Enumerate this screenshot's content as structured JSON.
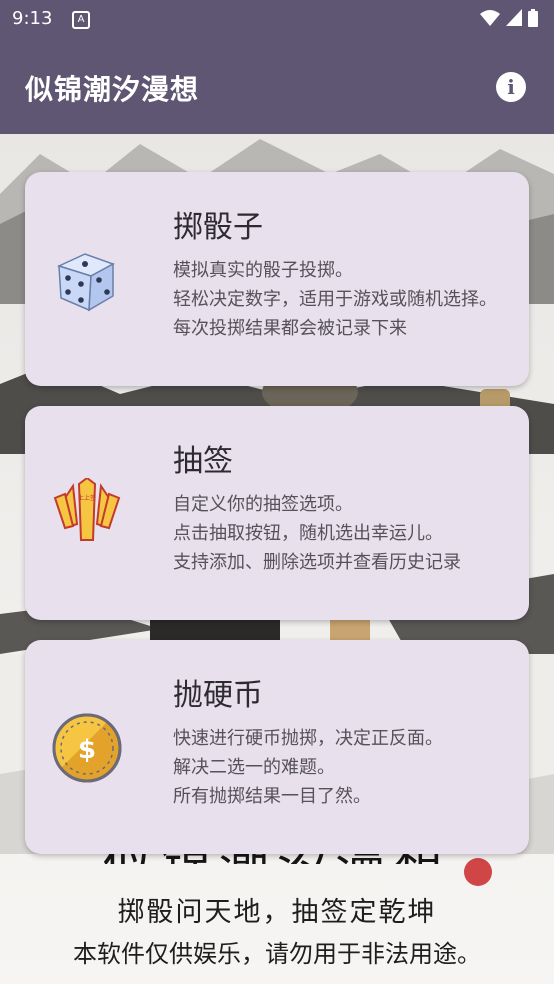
{
  "status": {
    "time": "9:13",
    "notif_glyph": "A"
  },
  "appbar": {
    "title": "似锦潮汐漫想"
  },
  "cards": [
    {
      "title": "掷骰子",
      "desc": [
        "模拟真实的骰子投掷。",
        "轻松决定数字，适用于游戏或随机选择。",
        "每次投掷结果都会被记录下来"
      ],
      "icon": "dice-icon"
    },
    {
      "title": "抽签",
      "desc": [
        "自定义你的抽签选项。",
        "点击抽取按钮，随机选出幸运儿。",
        "支持添加、删除选项并查看历史记录"
      ],
      "icon": "fortune-sticks-icon",
      "icon_text": "上上签"
    },
    {
      "title": "抛硬币",
      "desc": [
        "快速进行硬币抛掷，决定正反面。",
        "解决二选一的难题。",
        "所有抛掷结果一目了然。"
      ],
      "icon": "coin-icon",
      "icon_text": "$"
    }
  ],
  "background": {
    "calligraphy": "似锦潮汐漫想",
    "line1": "掷骰问天地，抽签定乾坤",
    "line2": "本软件仅供娱乐，请勿用于非法用途。"
  },
  "colors": {
    "bar": "#5f5673",
    "card": "#e8e0ec",
    "dice": "#c9d8f7",
    "sticks": "#f6c542",
    "coin": "#e3a229"
  }
}
